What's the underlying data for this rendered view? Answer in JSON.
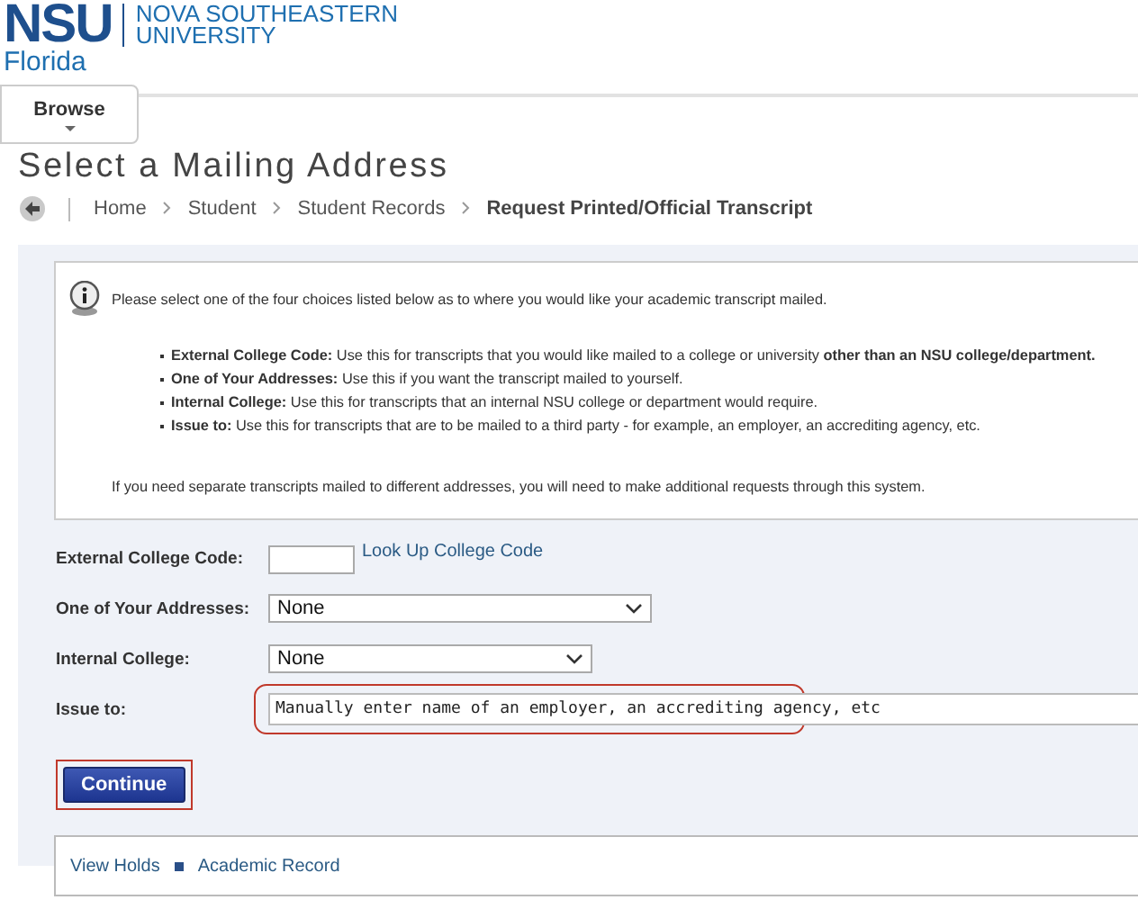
{
  "logo": {
    "mark": "NSU",
    "sub": "Florida",
    "name_lines": [
      "NOVA SOUTHEASTERN",
      "UNIVERSITY"
    ]
  },
  "browse_tab": {
    "label": "Browse"
  },
  "page_title": "Select a Mailing Address",
  "breadcrumb": [
    {
      "label": "Home",
      "current": false
    },
    {
      "label": "Student",
      "current": false
    },
    {
      "label": "Student Records",
      "current": false
    },
    {
      "label": "Request Printed/Official Transcript",
      "current": true
    }
  ],
  "info": {
    "intro": "Please select one of the four choices listed below as to where you would like your academic transcript mailed.",
    "bullets": [
      "**External College Code:** Use this for transcripts that you would like mailed to a college or university **other than an NSU college/department.**",
      "**One of Your Addresses:** Use this if you want the transcript mailed to yourself.",
      "**Internal College:** Use this for transcripts that an internal NSU college or department would require.",
      "**Issue to:** Use this for transcripts that are to be mailed to a third party - for example, an employer, an accrediting agency, etc."
    ],
    "note": "If you need separate transcripts mailed to different addresses, you will need to make additional requests through this system."
  },
  "form": [
    {
      "kind": "code",
      "label": "External College Code:",
      "link": "Look Up College Code",
      "highlighted": false
    },
    {
      "kind": "select",
      "label": "One of Your Addresses:",
      "value": "None",
      "highlighted": false
    },
    {
      "kind": "select_short",
      "label": "Internal College:",
      "value": "None",
      "highlighted": false
    },
    {
      "kind": "text",
      "label": "Issue to:",
      "value": "Manually enter name of an employer, an accrediting agency, etc",
      "highlighted": true
    }
  ],
  "continue_button": {
    "label": "Continue",
    "highlighted": true
  },
  "footer_links": [
    "View Holds",
    "Academic Record"
  ]
}
